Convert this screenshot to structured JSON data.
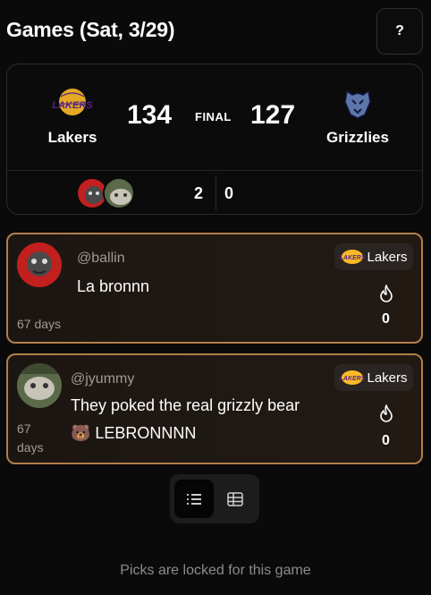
{
  "header": {
    "title": "Games (Sat, 3/29)",
    "help_label": "?"
  },
  "game": {
    "home_team": "Lakers",
    "away_team": "Grizzlies",
    "home_score": "134",
    "away_score": "127",
    "status": "FINAL",
    "home_picks": "2",
    "away_picks": "0",
    "logo_text": "LAKERS"
  },
  "picks": [
    {
      "username": "@ballin",
      "message": "La bronnn",
      "time": "67 days",
      "team": "Lakers",
      "fire_count": "0"
    },
    {
      "username": "@jyummy",
      "message_line1": "They poked the real grizzly bear",
      "message_line2": "🐻 LEBRONNNN",
      "time_line1": "67",
      "time_line2": "days",
      "team": "Lakers",
      "fire_count": "0"
    }
  ],
  "footer": {
    "locked_text": "Picks are locked for this game"
  },
  "colors": {
    "background": "#0a0a0a",
    "pick_border": "#b17f4a",
    "lakers_purple": "#552583",
    "lakers_gold": "#FDB927",
    "grizzlies_navy": "#5D76A9"
  },
  "icons": {
    "help": "question-mark-icon",
    "fire": "flame-icon",
    "list_view": "list-icon",
    "grid_view": "table-grid-icon"
  }
}
